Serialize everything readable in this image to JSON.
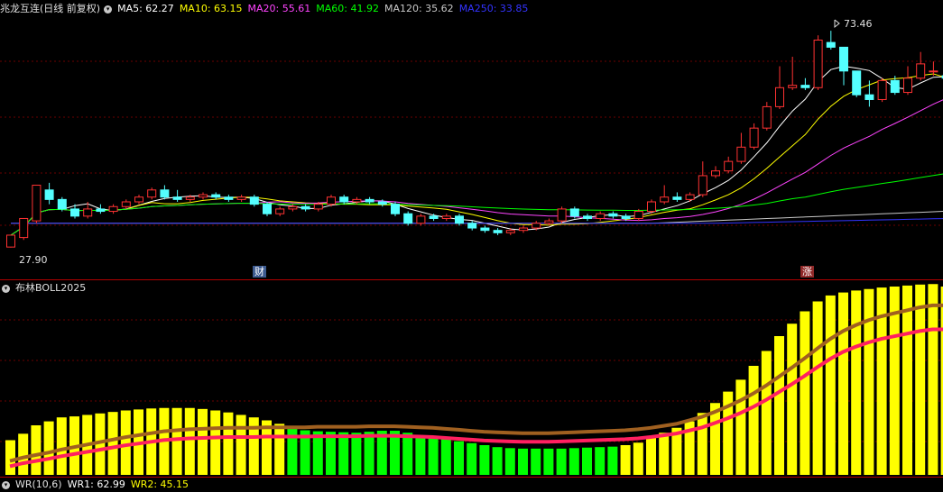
{
  "main_panel": {
    "title": "兆龙互连(日线 前复权)",
    "indicators": [
      {
        "label": "MA5: 62.27",
        "color": "#ffffff"
      },
      {
        "label": "MA10: 63.15",
        "color": "#ffff00"
      },
      {
        "label": "MA20: 55.61",
        "color": "#ff44ff"
      },
      {
        "label": "MA60: 41.92",
        "color": "#00ff00"
      },
      {
        "label": "MA120: 35.62",
        "color": "#c8c8c8"
      },
      {
        "label": "MA250: 33.85",
        "color": "#3333ff"
      }
    ],
    "high_label": "73.46",
    "low_label": "27.90",
    "events": [
      {
        "label": "财",
        "type": "finance",
        "color": "#4a6ea8"
      },
      {
        "label": "涨",
        "type": "limit-up",
        "color": "#b03030"
      }
    ]
  },
  "boll_panel": {
    "title": "布林BOLL2025"
  },
  "wr_panel": {
    "title": "WR(10,6)",
    "wr1": "WR1: 62.99",
    "wr2": "WR2: 45.15"
  },
  "colors": {
    "up": "#ff3232",
    "down": "#54ffff",
    "grid": "#6b0000",
    "boll_yellow": "#ffff00",
    "boll_green": "#00ff00",
    "boll_brown": "#a06020",
    "boll_red": "#ff2060"
  },
  "chart_data": {
    "type": "candlestick",
    "candles": [
      [
        28.0,
        30.5,
        27.9,
        30.0
      ],
      [
        30.0,
        34.0,
        29.5,
        33.5
      ],
      [
        33.5,
        41.0,
        33.0,
        40.0
      ],
      [
        40.0,
        38.0,
        37.0,
        41.5
      ],
      [
        38.0,
        36.0,
        35.5,
        38.5
      ],
      [
        36.0,
        34.5,
        34.0,
        37.0
      ],
      [
        34.5,
        36.0,
        34.0,
        37.5
      ],
      [
        36.0,
        35.5,
        35.0,
        37.0
      ],
      [
        35.5,
        36.5,
        35.0,
        37.0
      ],
      [
        36.5,
        37.5,
        36.0,
        38.0
      ],
      [
        37.5,
        38.5,
        37.0,
        39.0
      ],
      [
        38.5,
        40.0,
        38.0,
        40.5
      ],
      [
        40.0,
        38.5,
        38.0,
        41.0
      ],
      [
        38.5,
        38.0,
        37.5,
        40.0
      ],
      [
        38.0,
        38.5,
        37.5,
        39.0
      ],
      [
        38.5,
        39.0,
        38.0,
        39.5
      ],
      [
        39.0,
        38.5,
        38.0,
        39.5
      ],
      [
        38.5,
        38.0,
        37.5,
        39.0
      ],
      [
        38.0,
        38.5,
        37.5,
        39.0
      ],
      [
        38.5,
        37.0,
        36.5,
        39.0
      ],
      [
        37.0,
        35.0,
        34.5,
        37.5
      ],
      [
        35.0,
        36.0,
        34.5,
        36.5
      ],
      [
        36.0,
        36.5,
        35.5,
        37.0
      ],
      [
        36.5,
        36.0,
        35.5,
        37.0
      ],
      [
        36.0,
        37.0,
        35.5,
        37.5
      ],
      [
        37.0,
        38.5,
        36.5,
        39.0
      ],
      [
        38.5,
        37.5,
        37.0,
        39.0
      ],
      [
        37.5,
        38.0,
        37.0,
        38.5
      ],
      [
        38.0,
        37.5,
        37.0,
        38.5
      ],
      [
        37.5,
        37.0,
        36.5,
        38.0
      ],
      [
        37.0,
        35.0,
        34.5,
        37.5
      ],
      [
        35.0,
        33.0,
        32.5,
        35.5
      ],
      [
        33.0,
        34.5,
        32.5,
        35.0
      ],
      [
        34.5,
        34.0,
        33.5,
        35.0
      ],
      [
        34.0,
        34.5,
        33.5,
        35.0
      ],
      [
        34.5,
        33.0,
        32.5,
        35.0
      ],
      [
        33.0,
        32.0,
        31.5,
        33.5
      ],
      [
        32.0,
        31.5,
        31.0,
        32.5
      ],
      [
        31.5,
        31.0,
        30.5,
        32.0
      ],
      [
        31.0,
        31.5,
        30.5,
        32.0
      ],
      [
        31.5,
        32.0,
        31.0,
        32.5
      ],
      [
        32.0,
        33.0,
        31.5,
        33.5
      ],
      [
        33.0,
        33.5,
        32.5,
        34.0
      ],
      [
        33.5,
        36.0,
        33.0,
        36.5
      ],
      [
        36.0,
        34.5,
        34.0,
        36.5
      ],
      [
        34.5,
        34.0,
        33.5,
        35.0
      ],
      [
        34.0,
        35.0,
        33.5,
        35.5
      ],
      [
        35.0,
        34.5,
        34.0,
        35.5
      ],
      [
        34.5,
        34.0,
        33.5,
        35.0
      ],
      [
        34.0,
        35.5,
        33.5,
        36.0
      ],
      [
        35.5,
        37.5,
        35.0,
        38.0
      ],
      [
        37.5,
        38.5,
        37.0,
        41.0
      ],
      [
        38.5,
        38.0,
        37.5,
        39.5
      ],
      [
        38.0,
        39.0,
        37.5,
        39.5
      ],
      [
        39.0,
        43.0,
        38.5,
        46.0
      ],
      [
        43.0,
        44.0,
        42.5,
        45.0
      ],
      [
        44.0,
        46.0,
        43.5,
        47.0
      ],
      [
        46.0,
        49.0,
        45.5,
        52.0
      ],
      [
        49.0,
        53.0,
        48.5,
        54.0
      ],
      [
        53.0,
        57.5,
        52.5,
        58.5
      ],
      [
        57.5,
        61.5,
        57.0,
        66.0
      ],
      [
        61.5,
        62.0,
        61.0,
        68.0
      ],
      [
        62.0,
        61.5,
        61.0,
        63.5
      ],
      [
        61.5,
        71.5,
        61.0,
        72.5
      ],
      [
        71.0,
        70.0,
        69.5,
        73.46
      ],
      [
        70.0,
        65.0,
        62.0,
        70.0
      ],
      [
        65.0,
        60.0,
        59.5,
        65.0
      ],
      [
        60.0,
        59.0,
        57.5,
        63.0
      ],
      [
        59.0,
        63.0,
        58.5,
        63.5
      ],
      [
        63.0,
        60.5,
        60.0,
        64.0
      ],
      [
        60.5,
        63.5,
        60.0,
        66.0
      ],
      [
        63.5,
        66.5,
        63.0,
        69.0
      ],
      [
        65.0,
        65.0,
        64.0,
        67.0
      ],
      [
        64.0,
        63.5,
        62.5,
        65.0
      ]
    ],
    "boll": [
      [
        0.7,
        0.28
      ],
      [
        0.83,
        0.35
      ],
      [
        1.0,
        0.4
      ],
      [
        1.08,
        0.45
      ],
      [
        1.16,
        0.51
      ],
      [
        1.18,
        0.56
      ],
      [
        1.21,
        0.61
      ],
      [
        1.24,
        0.66
      ],
      [
        1.27,
        0.71
      ],
      [
        1.3,
        0.76
      ],
      [
        1.32,
        0.8
      ],
      [
        1.34,
        0.84
      ],
      [
        1.35,
        0.88
      ],
      [
        1.35,
        0.9
      ],
      [
        1.35,
        0.92
      ],
      [
        1.33,
        0.93
      ],
      [
        1.3,
        0.94
      ],
      [
        1.26,
        0.95
      ],
      [
        1.21,
        0.95
      ],
      [
        1.16,
        0.95
      ],
      [
        1.1,
        0.96
      ],
      [
        1.03,
        0.96
      ],
      [
        0.96,
        0.96
      ],
      [
        0.9,
        0.96
      ],
      [
        0.88,
        0.97
      ],
      [
        0.87,
        0.97
      ],
      [
        0.86,
        0.97
      ],
      [
        0.85,
        0.97
      ],
      [
        0.87,
        0.98
      ],
      [
        0.89,
        0.98
      ],
      [
        0.89,
        0.98
      ],
      [
        0.85,
        0.97
      ],
      [
        0.8,
        0.96
      ],
      [
        0.76,
        0.95
      ],
      [
        0.72,
        0.93
      ],
      [
        0.68,
        0.91
      ],
      [
        0.64,
        0.89
      ],
      [
        0.6,
        0.87
      ],
      [
        0.56,
        0.86
      ],
      [
        0.54,
        0.85
      ],
      [
        0.53,
        0.84
      ],
      [
        0.53,
        0.84
      ],
      [
        0.53,
        0.84
      ],
      [
        0.53,
        0.85
      ],
      [
        0.54,
        0.86
      ],
      [
        0.55,
        0.87
      ],
      [
        0.56,
        0.88
      ],
      [
        0.57,
        0.89
      ],
      [
        0.6,
        0.9
      ],
      [
        0.65,
        0.92
      ],
      [
        0.75,
        0.95
      ],
      [
        0.85,
        0.99
      ],
      [
        0.95,
        1.03
      ],
      [
        1.08,
        1.1
      ],
      [
        1.25,
        1.17
      ],
      [
        1.45,
        1.27
      ],
      [
        1.68,
        1.38
      ],
      [
        1.92,
        1.5
      ],
      [
        2.2,
        1.64
      ],
      [
        2.5,
        1.8
      ],
      [
        2.8,
        1.98
      ],
      [
        3.05,
        2.16
      ],
      [
        3.3,
        2.35
      ],
      [
        3.5,
        2.55
      ],
      [
        3.62,
        2.74
      ],
      [
        3.68,
        2.9
      ],
      [
        3.72,
        3.02
      ],
      [
        3.75,
        3.12
      ],
      [
        3.78,
        3.2
      ],
      [
        3.8,
        3.26
      ],
      [
        3.82,
        3.32
      ],
      [
        3.84,
        3.38
      ],
      [
        3.85,
        3.42
      ],
      [
        3.8,
        3.42
      ]
    ]
  }
}
